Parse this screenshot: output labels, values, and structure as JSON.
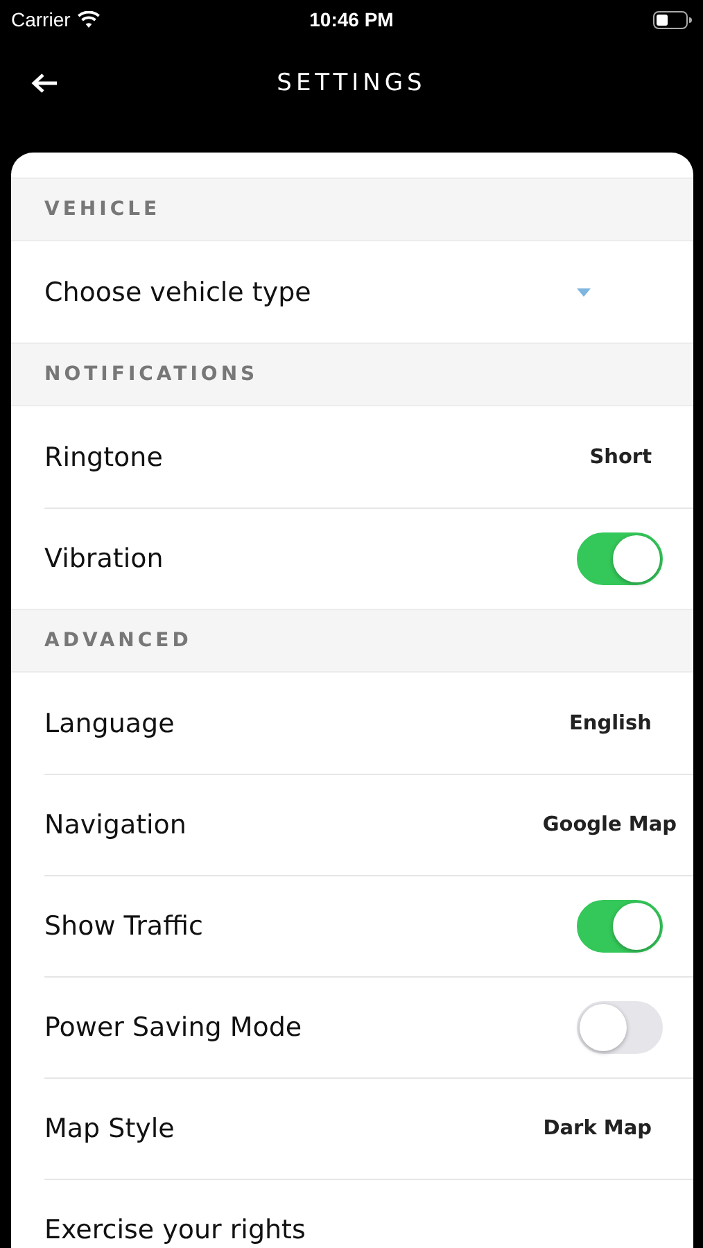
{
  "status_bar": {
    "carrier": "Carrier",
    "time": "10:46 PM"
  },
  "header": {
    "title": "SETTINGS"
  },
  "sections": [
    {
      "title": "VEHICLE",
      "items": [
        {
          "kind": "dropdown",
          "label": "Choose vehicle type"
        }
      ]
    },
    {
      "title": "NOTIFICATIONS",
      "items": [
        {
          "kind": "value",
          "label": "Ringtone",
          "value": "Short"
        },
        {
          "kind": "toggle",
          "label": "Vibration",
          "on": true
        }
      ]
    },
    {
      "title": "ADVANCED",
      "items": [
        {
          "kind": "value",
          "label": "Language",
          "value": "English"
        },
        {
          "kind": "value",
          "label": "Navigation",
          "value": "Google Map"
        },
        {
          "kind": "toggle",
          "label": "Show Traffic",
          "on": true
        },
        {
          "kind": "toggle",
          "label": "Power Saving Mode",
          "on": false
        },
        {
          "kind": "value",
          "label": "Map Style",
          "value": "Dark Map"
        },
        {
          "kind": "link",
          "label": "Exercise your rights"
        }
      ]
    }
  ]
}
